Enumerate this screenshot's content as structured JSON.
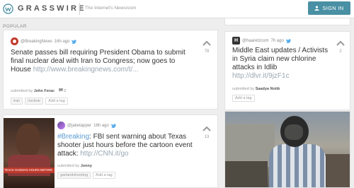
{
  "header": {
    "brand": "GRASSWIRE",
    "tagline": "The Internet's Newsroom",
    "signin_label": "SIGN IN"
  },
  "section": {
    "label": "POPULAR"
  },
  "posts": [
    {
      "handle": "@BreakingNews",
      "time": "16h ago",
      "headline": "Senate passes bill requiring President Obama to submit final nuclear deal with Iran to Congress; now goes to House",
      "link": "http://www.breakingnews.com/t/...",
      "submitted_prefix": "submitted by",
      "submitted_by": "John Ferac",
      "comments": "2",
      "tags": [
        "iran",
        "nuclear"
      ],
      "add_tag": "Add a tag",
      "votes": "78"
    },
    {
      "handle": "@jaketapper",
      "time": "16h ago",
      "hashtag": "#Breaking",
      "headline": ": FBI sent warning about Texas shooter just hours before the cartoon event attack:",
      "link": "http://CNN.it/go",
      "submitted_prefix": "submitted by",
      "submitted_by": "Jonny",
      "tags": [
        "garlandshooting"
      ],
      "add_tag": "Add a tag",
      "votes": "13",
      "thumb_banner": "TEXAS GUNMAN HOURS BEFORE"
    },
    {
      "handle": "@haaretzcom",
      "time": "7h ago",
      "headline": "Middle East updates / Activists in Syria claim new chlorine attacks in Idlib",
      "link": "http://dlvr.it/9jzF1c",
      "submitted_prefix": "submitted by",
      "submitted_by": "Saadya Notik",
      "add_tag": "Add a tag",
      "votes": "2",
      "avatar_letter": "H"
    }
  ],
  "icons": {
    "logo": "grasswire-logo-icon",
    "user": "user-icon",
    "twitter": "twitter-bird-icon",
    "upvote": "chevron-up-icon",
    "comment": "comment-icon"
  },
  "colors": {
    "accent": "#4a90a4",
    "link": "#9aa7b3",
    "hashtag": "#5a9bd5",
    "twitter": "#55acee"
  }
}
